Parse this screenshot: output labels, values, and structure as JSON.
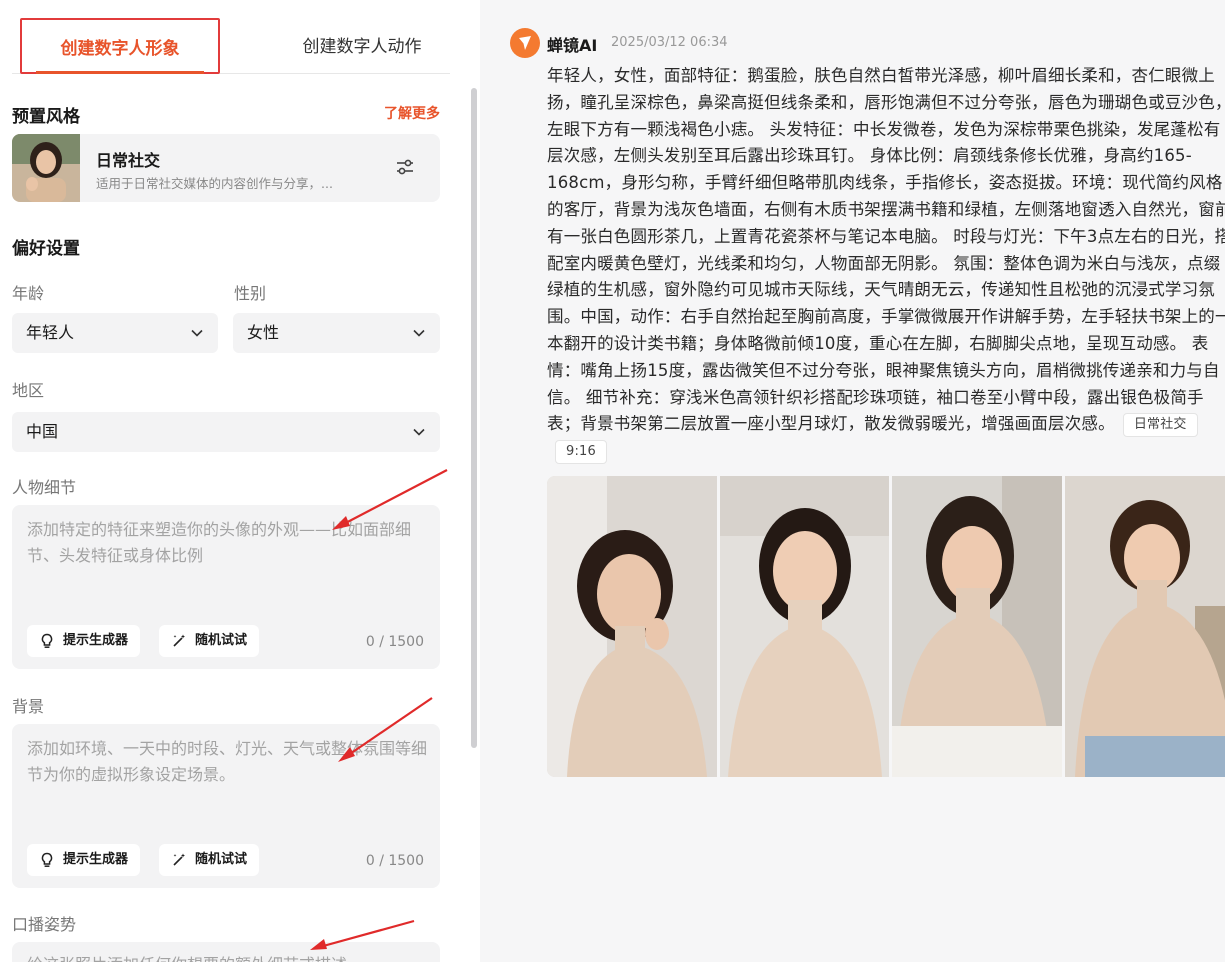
{
  "tabs": {
    "active": "创建数字人形象",
    "inactive": "创建数字人动作"
  },
  "preset": {
    "title": "预置风格",
    "learn_more": "了解更多",
    "style_name": "日常社交",
    "style_desc": "适用于日常社交媒体的内容创作与分享，..."
  },
  "preferences": {
    "title": "偏好设置",
    "age_label": "年龄",
    "age_value": "年轻人",
    "gender_label": "性别",
    "gender_value": "女性",
    "region_label": "地区",
    "region_value": "中国"
  },
  "details": {
    "label": "人物细节",
    "placeholder": "添加特定的特征来塑造你的头像的外观——比如面部细节、头发特征或身体比例",
    "prompt_btn": "提示生成器",
    "random_btn": "随机试试",
    "counter": "0 / 1500"
  },
  "background": {
    "label": "背景",
    "placeholder": "添加如环境、一天中的时段、灯光、天气或整体氛围等细节为你的虚拟形象设定场景。",
    "prompt_btn": "提示生成器",
    "random_btn": "随机试试",
    "counter": "0 / 1500"
  },
  "pose": {
    "label": "口播姿势",
    "placeholder": "给这张照片添加任何你想要的额外细节或描述"
  },
  "message": {
    "sender": "蝉镜AI",
    "time": "2025/03/12 06:34",
    "text": "年轻人，女性，面部特征：鹅蛋脸，肤色自然白皙带光泽感，柳叶眉细长柔和，杏仁眼微上扬，瞳孔呈深棕色，鼻梁高挺但线条柔和，唇形饱满但不过分夸张，唇色为珊瑚色或豆沙色，左眼下方有一颗浅褐色小痣。 头发特征：中长发微卷，发色为深棕带栗色挑染，发尾蓬松有层次感，左侧头发别至耳后露出珍珠耳钉。 身体比例：肩颈线条修长优雅，身高约165-168cm，身形匀称，手臂纤细但略带肌肉线条，手指修长，姿态挺拔。环境：现代简约风格的客厅，背景为浅灰色墙面，右侧有木质书架摆满书籍和绿植，左侧落地窗透入自然光，窗前有一张白色圆形茶几，上置青花瓷茶杯与笔记本电脑。 时段与灯光：下午3点左右的日光，搭配室内暖黄色壁灯，光线柔和均匀，人物面部无阴影。 氛围：整体色调为米白与浅灰，点缀绿植的生机感，窗外隐约可见城市天际线，天气晴朗无云，传递知性且松弛的沉浸式学习氛围。中国，动作：右手自然抬起至胸前高度，手掌微微展开作讲解手势，左手轻扶书架上的一本翻开的设计类书籍；身体略微前倾10度，重心在左脚，右脚脚尖点地，呈现互动感。 表情：嘴角上扬15度，露齿微笑但不过分夸张，眼神聚焦镜头方向，眉梢微挑传递亲和力与自信。 细节补充：穿浅米色高领针织衫搭配珍珠项链，袖口卷至小臂中段，露出银色极简手表；背景书架第二层放置一座小型月球灯，散发微弱暖光，增强画面层次感。",
    "tag1": "日常社交",
    "tag2": "9:16"
  },
  "colors": {
    "accent": "#e8542b",
    "highlight_box": "#e23b3b",
    "panel_bg": "#f3f3f4"
  },
  "icons": [
    "adjust-icon",
    "chevron-down-icon",
    "bulb-icon",
    "magic-wand-icon",
    "logo-icon"
  ]
}
